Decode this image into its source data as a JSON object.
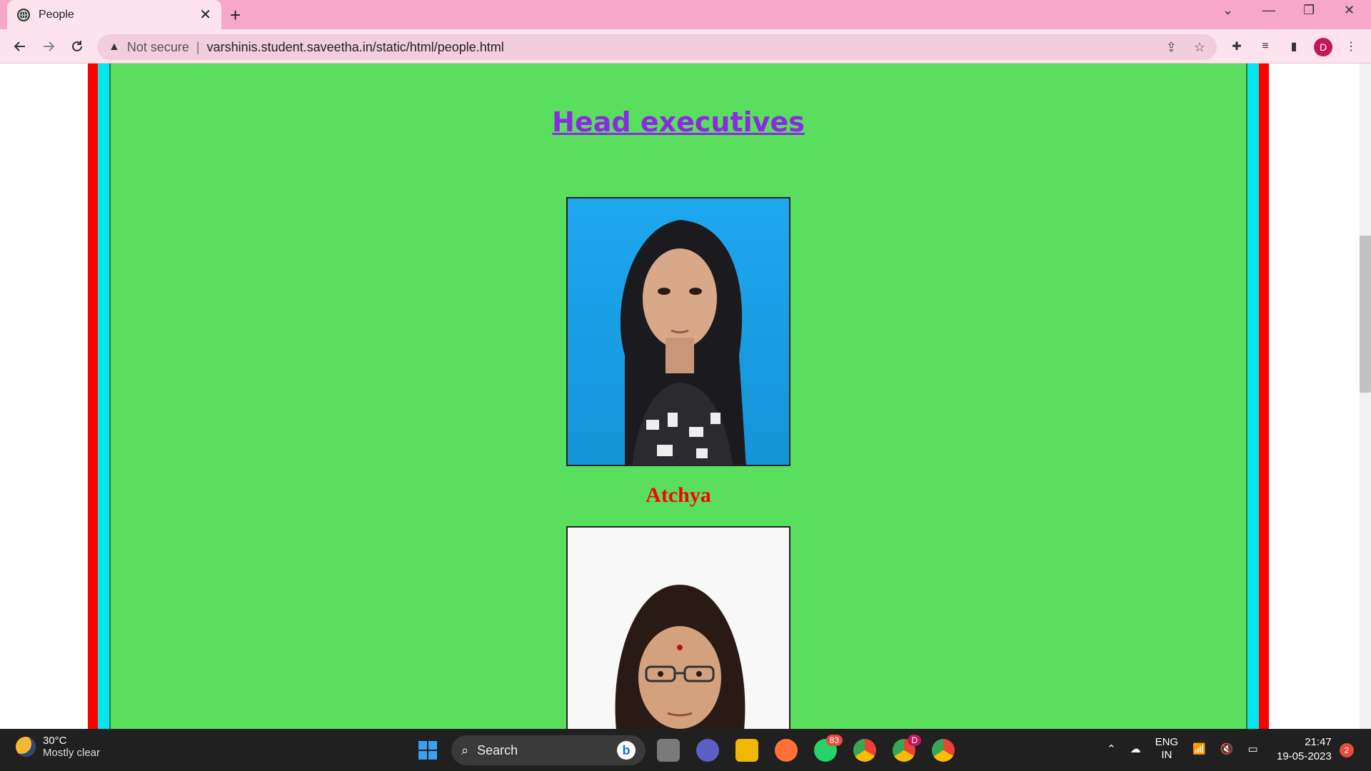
{
  "browser": {
    "tab_title": "People",
    "security_label": "Not secure",
    "url": "varshinis.student.saveetha.in/static/html/people.html",
    "profile_initial": "D"
  },
  "page": {
    "heading": "Head executives",
    "people": [
      {
        "name": "Atchya"
      },
      {
        "name": ""
      }
    ],
    "colors": {
      "background": "#5ade5e",
      "border_outer": "#ff0000",
      "border_inner": "#00e5ee",
      "heading": "#8a2be2",
      "name": "#ff0000"
    }
  },
  "taskbar": {
    "weather_temp": "30°C",
    "weather_desc": "Mostly clear",
    "search_label": "Search",
    "whatsapp_badge": "83",
    "chrome_profile_badge": "D",
    "lang_line1": "ENG",
    "lang_line2": "IN",
    "time": "21:47",
    "date": "19-05-2023",
    "notification_count": "2"
  }
}
